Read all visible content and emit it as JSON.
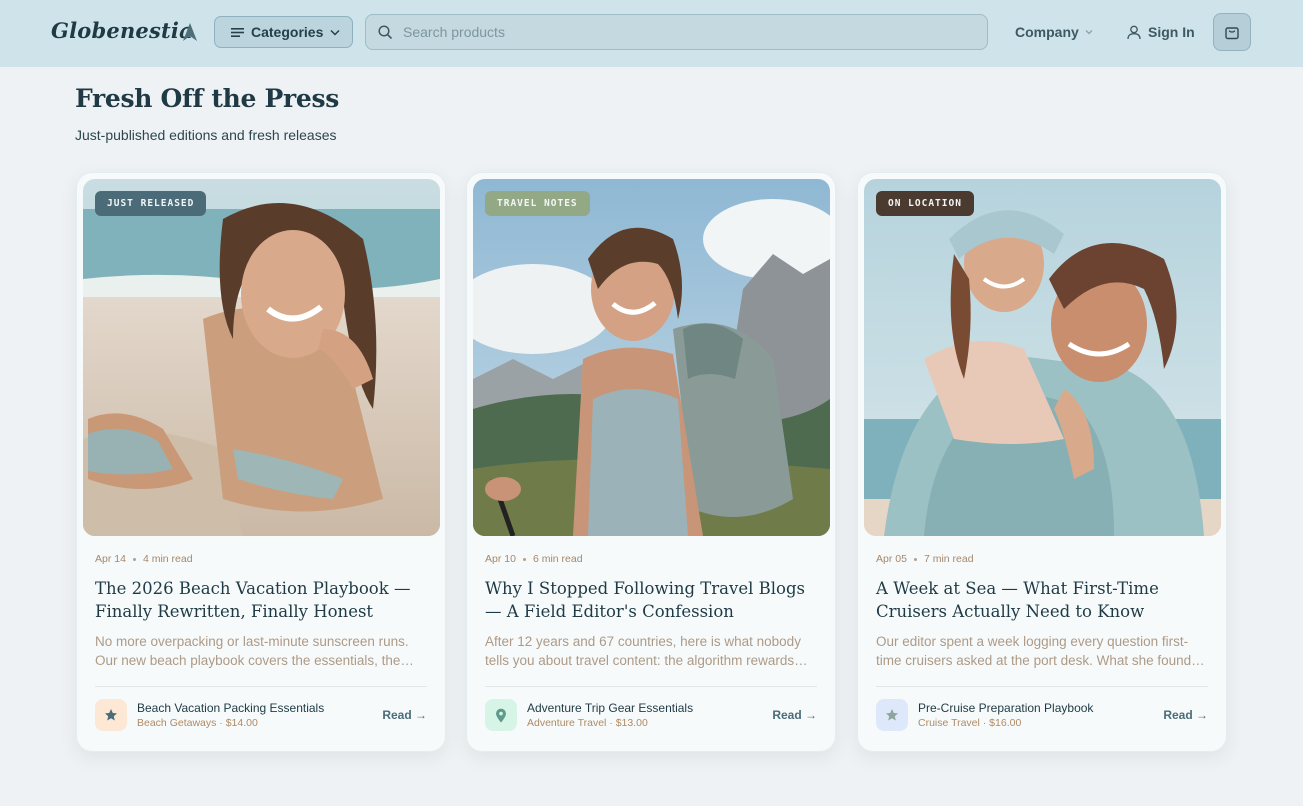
{
  "header": {
    "brand": "Globenestia",
    "categories_label": "Categories",
    "search_placeholder": "Search products",
    "company_label": "Company",
    "signin_label": "Sign In"
  },
  "section": {
    "title": "Fresh Off the Press",
    "subtitle": "Just-published editions and fresh releases"
  },
  "cards": [
    {
      "tag": "JUST RELEASED",
      "tag_color": "#4b6b78",
      "date": "Apr 14",
      "read_time": "4 min read",
      "title": "The 2026 Beach Vacation Playbook — Finally Rewritten, Finally Honest",
      "excerpt": "No more overpacking or last-minute sunscreen runs. Our new beach playbook covers the essentials, the…",
      "product_name": "Beach Vacation Packing Essentials",
      "product_meta": "Beach Getaways · $14.00",
      "product_icon": "star-icon",
      "read_label": "Read →"
    },
    {
      "tag": "TRAVEL NOTES",
      "tag_color": "#93a885",
      "date": "Apr 10",
      "read_time": "6 min read",
      "title": "Why I Stopped Following Travel Blogs — A Field Editor's Confession",
      "excerpt": "After 12 years and 67 countries, here is what nobody tells you about travel content: the algorithm rewards…",
      "product_name": "Adventure Trip Gear Essentials",
      "product_meta": "Adventure Travel · $13.00",
      "product_icon": "map-pin-icon",
      "read_label": "Read →"
    },
    {
      "tag": "ON LOCATION",
      "tag_color": "#4a3a30",
      "date": "Apr 05",
      "read_time": "7 min read",
      "title": "A Week at Sea — What First-Time Cruisers Actually Need to Know",
      "excerpt": "Our editor spent a week logging every question first-time cruisers asked at the port desk. What she found…",
      "product_name": "Pre-Cruise Preparation Playbook",
      "product_meta": "Cruise Travel · $16.00",
      "product_icon": "star-icon",
      "read_label": "Read →"
    }
  ]
}
